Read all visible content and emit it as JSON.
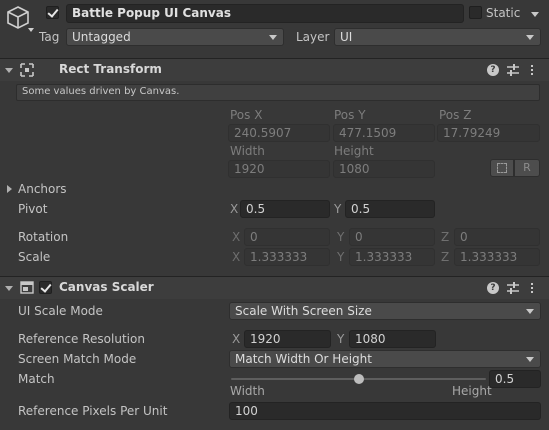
{
  "header": {
    "active": true,
    "object_name": "Battle Popup UI Canvas",
    "static_label": "Static",
    "static_checked": false,
    "tag_label": "Tag",
    "tag_value": "Untagged",
    "layer_label": "Layer",
    "layer_value": "UI"
  },
  "rect_transform": {
    "title": "Rect Transform",
    "info_text": "Some values driven by Canvas.",
    "pos_x_label": "Pos X",
    "pos_y_label": "Pos Y",
    "pos_z_label": "Pos Z",
    "pos_x": "240.5907",
    "pos_y": "477.1509",
    "pos_z": "17.79249",
    "width_label": "Width",
    "height_label": "Height",
    "width": "1920",
    "height": "1080",
    "raw_button": "R",
    "anchors_label": "Anchors",
    "pivot_label": "Pivot",
    "pivot_x": "0.5",
    "pivot_y": "0.5",
    "rotation_label": "Rotation",
    "rotation_x": "0",
    "rotation_y": "0",
    "rotation_z": "0",
    "scale_label": "Scale",
    "scale_x": "1.333333",
    "scale_y": "1.333333",
    "scale_z": "1.333333",
    "axis_x": "X",
    "axis_y": "Y",
    "axis_z": "Z"
  },
  "canvas_scaler": {
    "title": "Canvas Scaler",
    "enabled": true,
    "ui_scale_mode_label": "UI Scale Mode",
    "ui_scale_mode": "Scale With Screen Size",
    "ref_resolution_label": "Reference Resolution",
    "ref_res_x": "1920",
    "ref_res_y": "1080",
    "screen_match_mode_label": "Screen Match Mode",
    "screen_match_mode": "Match Width Or Height",
    "match_label": "Match",
    "match_value": "0.5",
    "match_fraction": 0.5,
    "match_min_label": "Width",
    "match_max_label": "Height",
    "ref_ppu_label": "Reference Pixels Per Unit",
    "ref_ppu": "100"
  },
  "icons": [
    "gameobject-cube-icon",
    "rect-transform-icon",
    "canvas-scaler-icon",
    "help-icon",
    "presets-icon",
    "kebab-menu-icon",
    "blueprint-icon"
  ]
}
